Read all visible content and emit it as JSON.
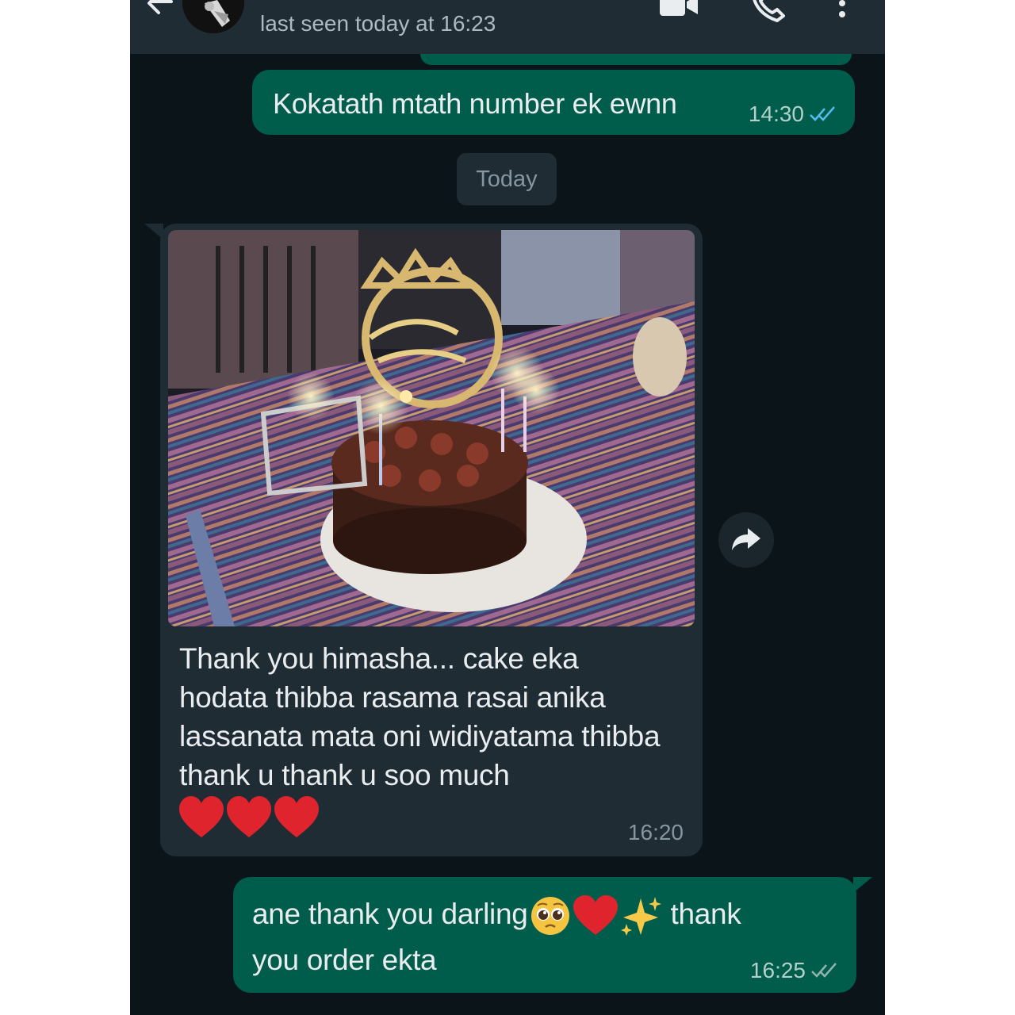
{
  "header": {
    "status": "last seen today at 16:23",
    "icons": [
      "back-arrow-icon",
      "avatar",
      "video-call-icon",
      "voice-call-icon",
      "more-vert-icon"
    ]
  },
  "messages": [
    {
      "direction": "outgoing",
      "text": "Kokatath mtath number ek ewnn",
      "time": "14:30",
      "status": "read"
    },
    {
      "direction": "incoming",
      "type": "image",
      "image_description": "chocolate birthday cake with lit candles and a gold Happy Birthday topper",
      "text": "Thank you himasha... cake eka hodata thibba rasama rasai anika lassanata mata oni widiyatama thibba thank u thank u soo much",
      "emoji": [
        "red-heart",
        "red-heart",
        "red-heart"
      ],
      "time": "16:20"
    },
    {
      "direction": "outgoing",
      "text_before_emoji": "ane thank you darling",
      "emoji": [
        "pleading-face",
        "red-heart",
        "sparkles"
      ],
      "text_after_emoji": "thank you order ekta",
      "time": "16:25",
      "status": "read"
    }
  ],
  "date_separator": "Today",
  "colors": {
    "background": "#0b1419",
    "header": "#1f2c34",
    "outgoing_bubble": "#005c4b",
    "incoming_bubble": "#1f2c34",
    "read_ticks": "#53bdeb",
    "heart": "#e0242e"
  }
}
